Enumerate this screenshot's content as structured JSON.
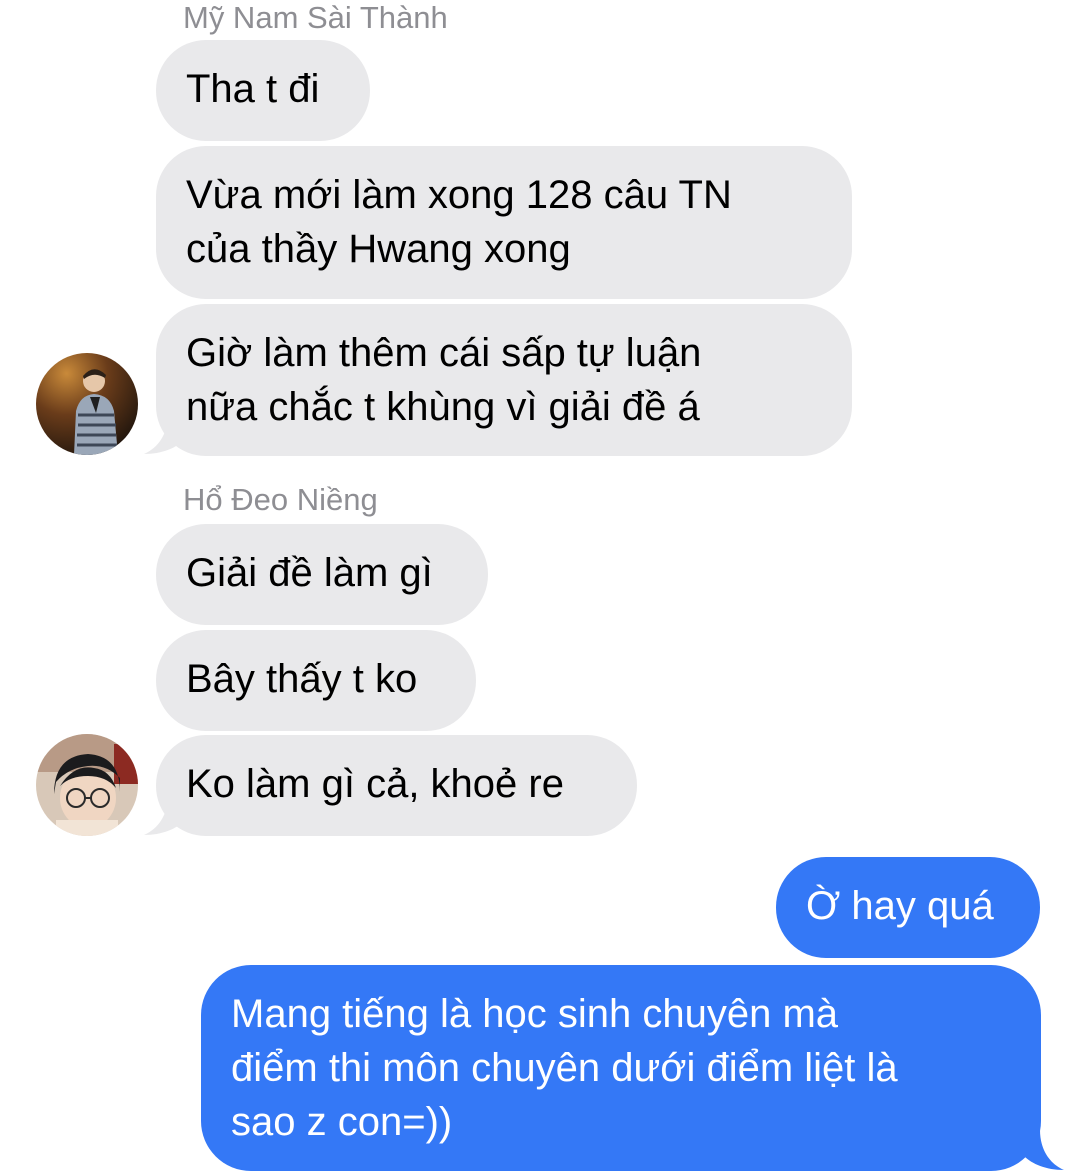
{
  "thread": {
    "groups": [
      {
        "sender": "Mỹ Nam Sài Thành",
        "messages": [
          {
            "lines": [
              "Tha t đi"
            ]
          },
          {
            "lines": [
              "Vừa mới làm xong 128 câu TN",
              "của thầy Hwang xong"
            ]
          },
          {
            "lines": [
              "Giờ làm thêm cái sấp tự luận",
              "nữa chắc t khùng vì giải đề á"
            ]
          }
        ]
      },
      {
        "sender": "Hổ Đeo Niềng",
        "messages": [
          {
            "lines": [
              "Giải đề làm gì"
            ]
          },
          {
            "lines": [
              "Bây thấy t ko"
            ]
          },
          {
            "lines": [
              "Ko làm gì cả, khoẻ re"
            ]
          }
        ]
      }
    ],
    "outgoing": [
      {
        "lines": [
          "Ờ hay quá"
        ]
      },
      {
        "lines": [
          "Mang tiếng là học sinh chuyên mà",
          "điểm thi môn chuyên dưới điểm liệt là",
          "sao z con=))"
        ]
      }
    ]
  },
  "colors": {
    "incoming_bubble": "#e9e9eb",
    "outgoing_bubble": "#3478f6",
    "sender_label": "#8e8e93"
  }
}
